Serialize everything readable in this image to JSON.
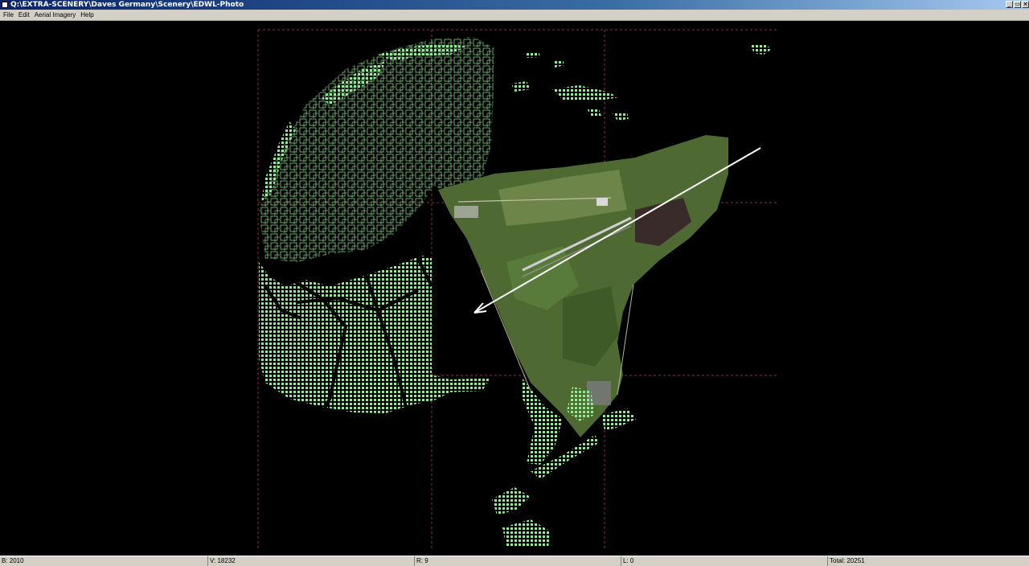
{
  "window": {
    "title": "Q:\\EXTRA-SCENERY\\Daves Germany\\Scenery\\EDWL-Photo",
    "controls": {
      "minimize": "_",
      "restore": "▭",
      "close": "×"
    }
  },
  "menu": {
    "items": [
      "File",
      "Edit",
      "Aerial Imagery",
      "Help"
    ]
  },
  "statusbar": {
    "b": "B: 2010",
    "v": "V: 18232",
    "r": "R: 9",
    "l": "L: 0",
    "total": "Total: 20251"
  },
  "colors": {
    "grid_line": "#b0203a",
    "vector_point": "#90ee90",
    "aerial_field": "#4e6a32",
    "arrow": "#ffffff"
  }
}
